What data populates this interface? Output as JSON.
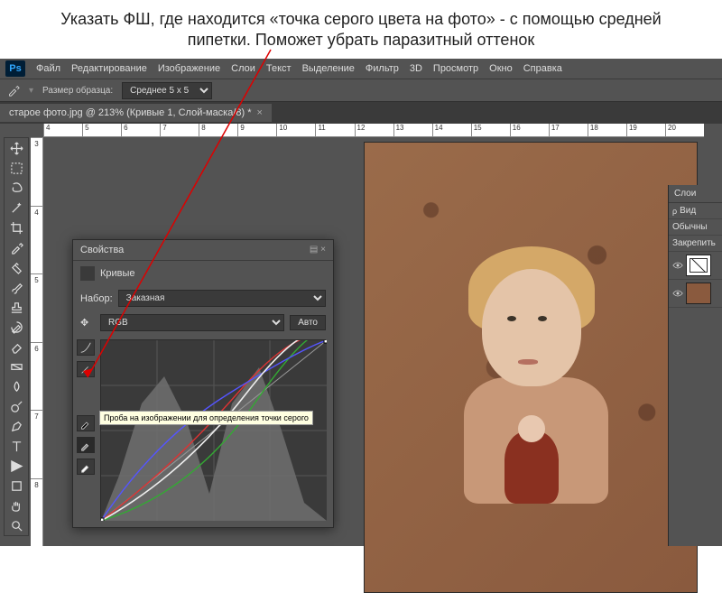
{
  "slide": {
    "title": "Указать ФШ, где находится «точка серого цвета на фото» - с помощью средней пипетки. Поможет убрать паразитный оттенок"
  },
  "app": {
    "logo": "Ps"
  },
  "menu": {
    "file": "Файл",
    "edit": "Редактирование",
    "image": "Изображение",
    "layer": "Слои",
    "type": "Текст",
    "select": "Выделение",
    "filter": "Фильтр",
    "threed": "3D",
    "view": "Просмотр",
    "window": "Окно",
    "help": "Справка"
  },
  "optbar": {
    "sample_label": "Размер образца:",
    "sample_value": "Среднее 5 x 5"
  },
  "tab": {
    "title": "старое фото.jpg @ 213% (Кривые 1, Слой-маска/8) *",
    "close": "×"
  },
  "ruler_h": [
    "4",
    "5",
    "6",
    "7",
    "8",
    "9",
    "10",
    "11",
    "12",
    "13",
    "14",
    "15",
    "16",
    "17",
    "18",
    "19",
    "20"
  ],
  "ruler_v": [
    "3",
    "4",
    "5",
    "6",
    "7",
    "8"
  ],
  "tools": {
    "move": "move-tool",
    "marquee": "marquee-tool",
    "lasso": "lasso-tool",
    "wand": "wand-tool",
    "crop": "crop-tool",
    "eyedropper": "eyedropper-tool",
    "heal": "heal-tool",
    "brush": "brush-tool",
    "stamp": "stamp-tool",
    "history": "history-brush-tool",
    "eraser": "eraser-tool",
    "gradient": "gradient-tool",
    "blur": "blur-tool",
    "dodge": "dodge-tool",
    "pen": "pen-tool",
    "type": "type-tool",
    "path": "path-tool",
    "shape": "shape-tool",
    "hand": "hand-tool",
    "zoom": "zoom-tool"
  },
  "props": {
    "header": "Свойства",
    "type_label": "Кривые",
    "preset_label": "Набор:",
    "preset_value": "Заказная",
    "channel_value": "RGB",
    "auto_btn": "Авто",
    "gray_tooltip": "Проба на изображении для определения точки серого"
  },
  "layers": {
    "header": "Слои",
    "kind_label": "Вид",
    "mode": "Обычны",
    "lock_label": "Закрепить"
  }
}
